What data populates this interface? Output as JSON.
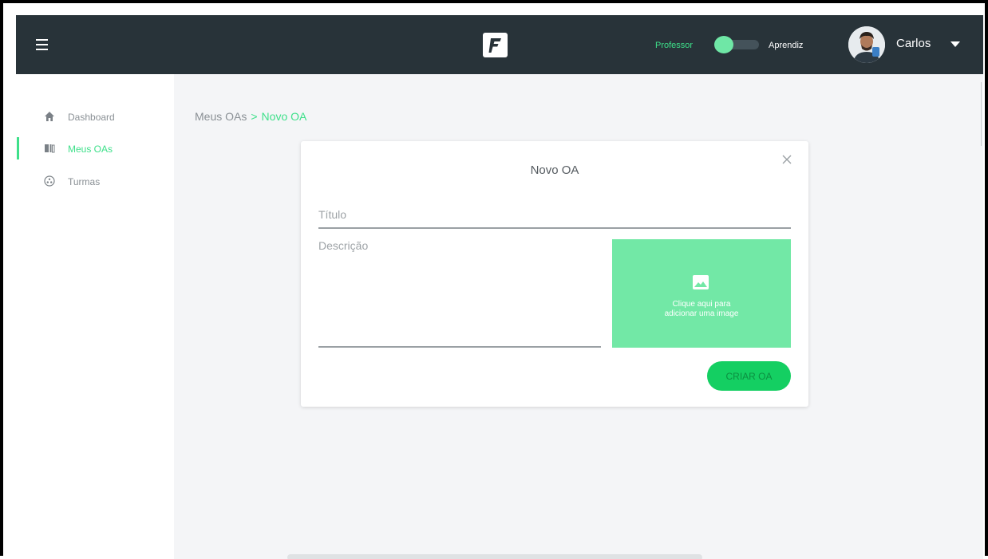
{
  "header": {
    "mode_left": "Professor",
    "mode_right": "Aprendiz",
    "user_name": "Carlos"
  },
  "sidebar": {
    "items": [
      {
        "label": "Dashboard",
        "icon": "home-icon",
        "active": false
      },
      {
        "label": "Meus OAs",
        "icon": "book-icon",
        "active": true
      },
      {
        "label": "Turmas",
        "icon": "group-icon",
        "active": false
      }
    ]
  },
  "breadcrumb": {
    "parent": "Meus OAs",
    "separator": ">",
    "current": "Novo OA"
  },
  "modal": {
    "title": "Novo OA",
    "title_placeholder": "Título",
    "description_placeholder": "Descrição",
    "image_text_line1": "Clique aqui para",
    "image_text_line2": "adicionar uma image",
    "create_label": "CRIAR OA"
  },
  "colors": {
    "accent": "#3ee08a",
    "header_bg": "#283339",
    "button_green": "#14cf62",
    "image_box": "#72e8a6"
  }
}
